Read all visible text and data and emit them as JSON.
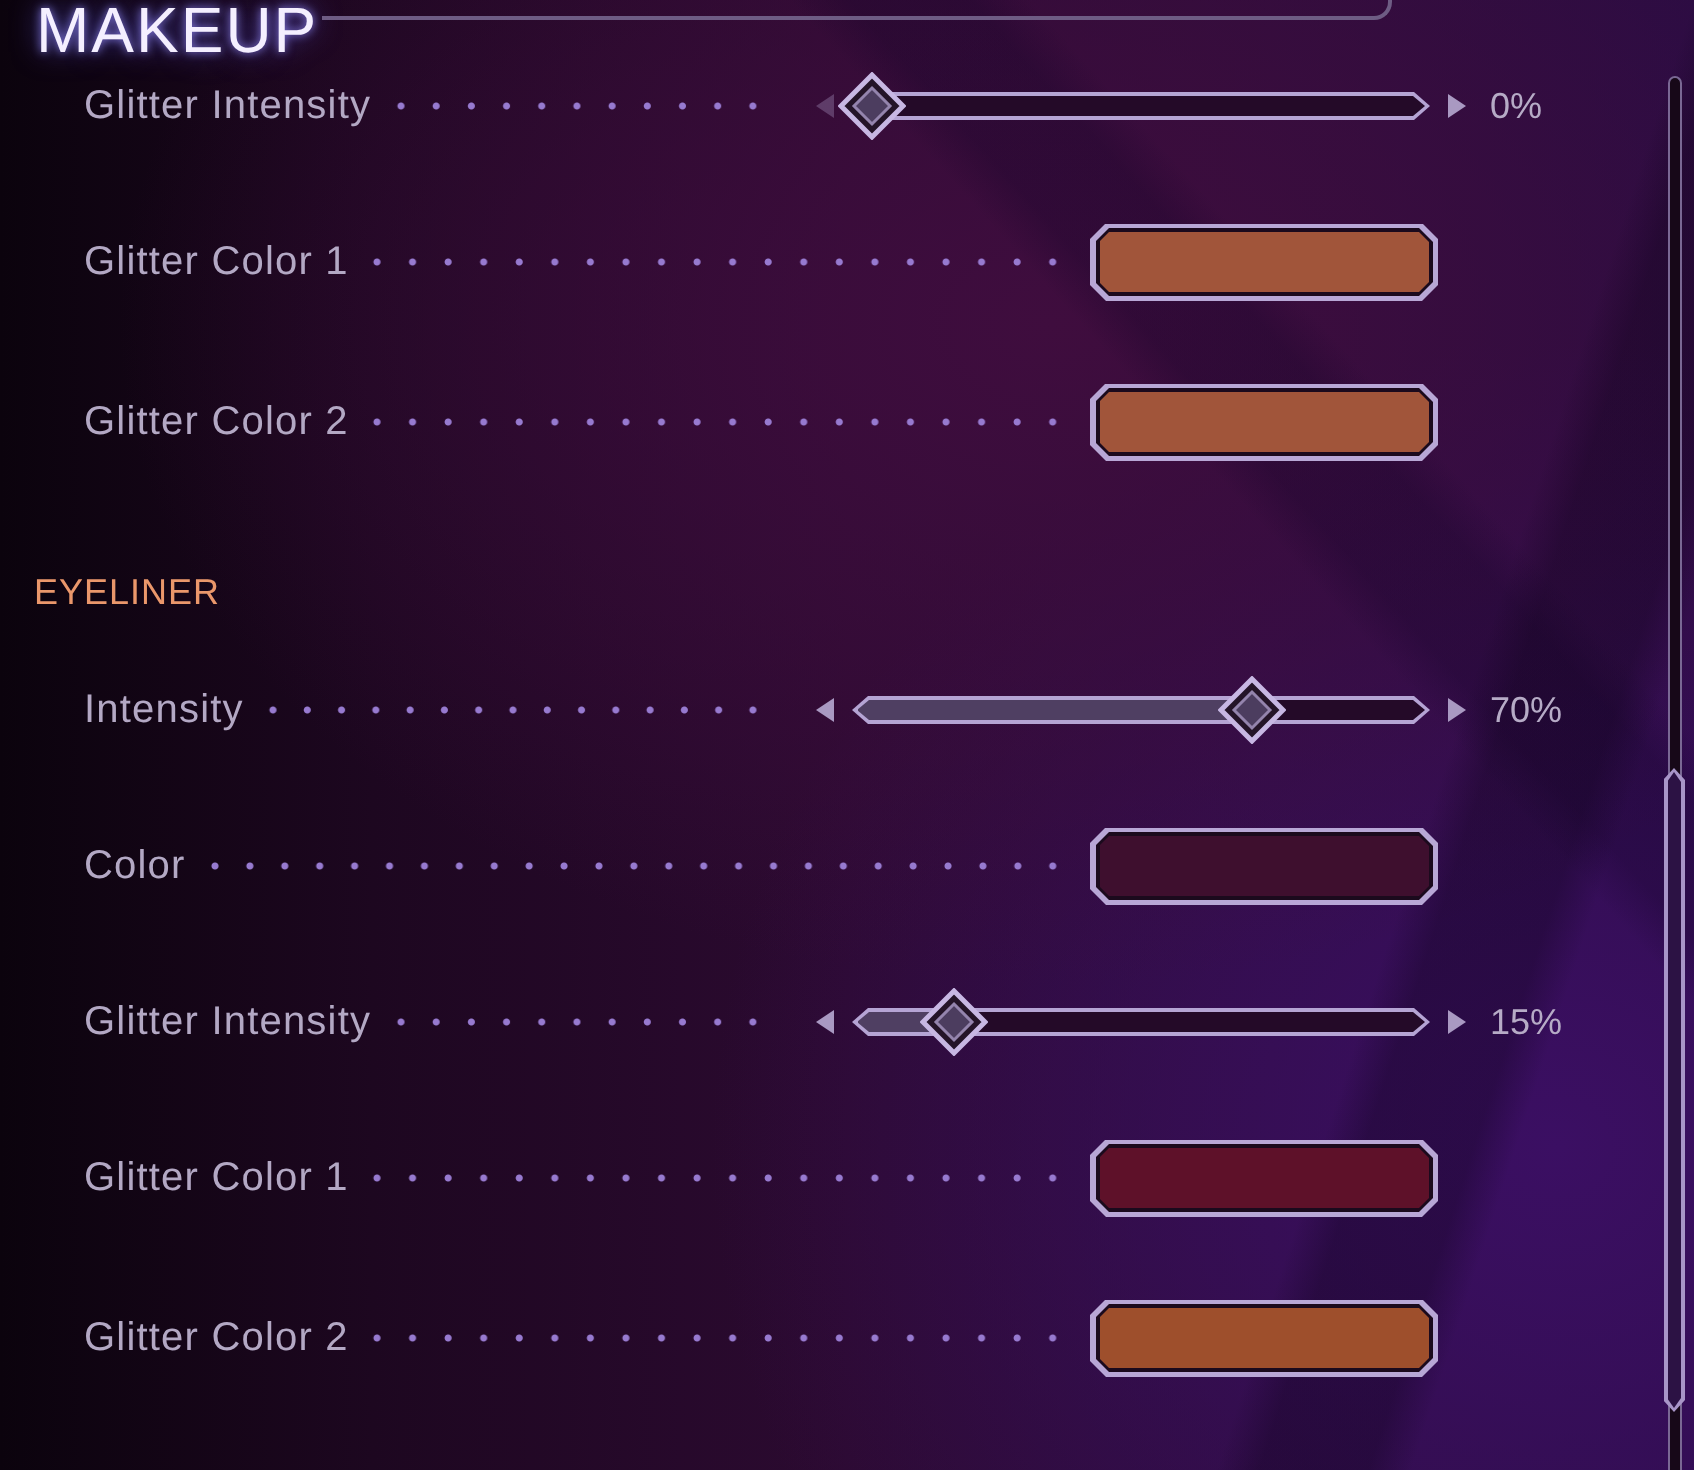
{
  "sections": [
    {
      "kind": "title",
      "title": "MAKEUP",
      "settings": [
        {
          "kind": "slider",
          "label": "Glitter Intensity",
          "level": 0,
          "reading": "0%"
        },
        {
          "kind": "color",
          "label": "Glitter Color 1",
          "color": "#a1553a"
        },
        {
          "kind": "color",
          "label": "Glitter Color 2",
          "color": "#a1553a"
        }
      ]
    },
    {
      "kind": "heading",
      "title": "EYELINER",
      "settings": [
        {
          "kind": "slider",
          "label": "Intensity",
          "level": 0.7,
          "reading": "70%"
        },
        {
          "kind": "color",
          "label": "Color",
          "color": "#3e0f2e"
        },
        {
          "kind": "slider",
          "label": "Glitter Intensity",
          "level": 0.15,
          "reading": "15%"
        },
        {
          "kind": "color",
          "label": "Glitter Color 1",
          "color": "#5e1129"
        },
        {
          "kind": "color",
          "label": "Glitter Color 2",
          "color": "#9e4f2c"
        }
      ]
    }
  ]
}
